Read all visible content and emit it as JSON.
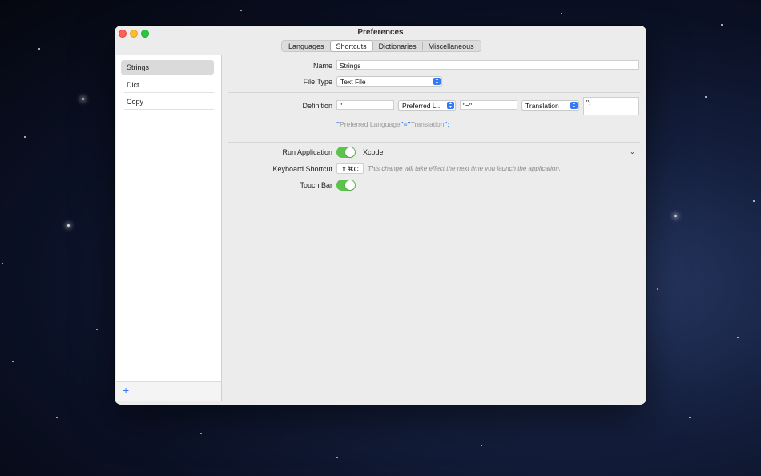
{
  "window": {
    "title": "Preferences",
    "tabs": [
      {
        "label": "Languages",
        "active": false
      },
      {
        "label": "Shortcuts",
        "active": true
      },
      {
        "label": "Dictionaries",
        "active": false
      },
      {
        "label": "Miscellaneous",
        "active": false
      }
    ]
  },
  "sidebar": {
    "items": [
      {
        "label": "Strings",
        "selected": true
      },
      {
        "label": "Dict",
        "selected": false
      },
      {
        "label": "Copy",
        "selected": false
      }
    ],
    "add_label": "+"
  },
  "form": {
    "name_label": "Name",
    "name_value": "Strings",
    "file_type_label": "File Type",
    "file_type_value": "Text File",
    "definition_label": "Definition",
    "definition": {
      "prefix": "\"",
      "key_popup": "Preferred L...",
      "separator": "\"=\"",
      "value_popup": "Translation",
      "suffix": "\";"
    },
    "preview": {
      "q1": "\"",
      "t1": "Preferred Language",
      "q2": "\"=\"",
      "t2": "Translation",
      "q3": "\";"
    },
    "run_application_label": "Run Application",
    "run_application_on": true,
    "run_application_value": "Xcode",
    "keyboard_shortcut_label": "Keyboard Shortcut",
    "keyboard_shortcut_value": "⇧⌘C",
    "keyboard_shortcut_hint": "This change will take effect the next time you launch the application.",
    "touch_bar_label": "Touch Bar",
    "touch_bar_on": true
  },
  "colors": {
    "accent": "#3479f6",
    "toggle_on": "#5ec24f"
  },
  "icons": {
    "close": "close-icon",
    "minimize": "minimize-icon",
    "maximize": "maximize-icon",
    "stepper": "stepper-icon",
    "chevron": "chevron-down-icon",
    "add": "plus-icon"
  }
}
